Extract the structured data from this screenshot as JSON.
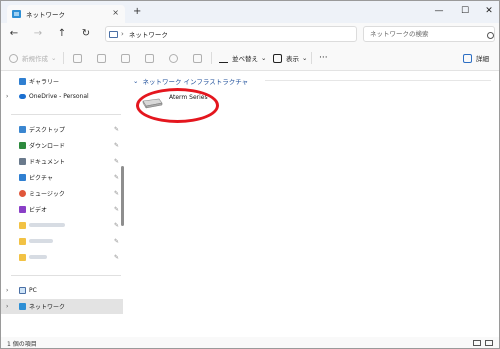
{
  "window": {
    "tab_title": "ネットワーク",
    "tab_close": "×",
    "new_tab": "+",
    "minimize": "—",
    "maximize": "☐",
    "close": "✕"
  },
  "nav": {
    "back": "←",
    "forward": "→",
    "up": "↑",
    "refresh": "↻"
  },
  "address": {
    "separator": "›",
    "location": "ネットワーク"
  },
  "search": {
    "placeholder": "ネットワークの検索"
  },
  "toolbar": {
    "new_label": "新規作成",
    "new_chevron": "⌄",
    "sort_label": "並べ替え",
    "sort_chevron": "⌄",
    "view_label": "表示",
    "view_chevron": "⌄",
    "more_label": "···",
    "details_label": "詳細"
  },
  "sidebar": {
    "gallery": "ギャラリー",
    "onedrive": "OneDrive - Personal",
    "quick_access": [
      {
        "label": "デスクトップ",
        "icon": "desktop-icon",
        "color": "#3a86d0"
      },
      {
        "label": "ダウンロード",
        "icon": "download-icon",
        "color": "#2d8a3e"
      },
      {
        "label": "ドキュメント",
        "icon": "documents-icon",
        "color": "#6a7a8c"
      },
      {
        "label": "ピクチャ",
        "icon": "pictures-icon",
        "color": "#2f7fd1"
      },
      {
        "label": "ミュージック",
        "icon": "music-icon",
        "color": "#e0563a"
      },
      {
        "label": "ビデオ",
        "icon": "videos-icon",
        "color": "#8a3fc7"
      }
    ],
    "pin_glyph": "✎",
    "pc": "PC",
    "network": "ネットワーク"
  },
  "content": {
    "group_title": "ネットワーク インフラストラクチャ",
    "device_name": "Aterm Series"
  },
  "status": {
    "item_count": "1 個の項目"
  },
  "colors": {
    "accent": "#1d4e9a",
    "highlight": "#e4161e",
    "folder": "#f2c244"
  }
}
